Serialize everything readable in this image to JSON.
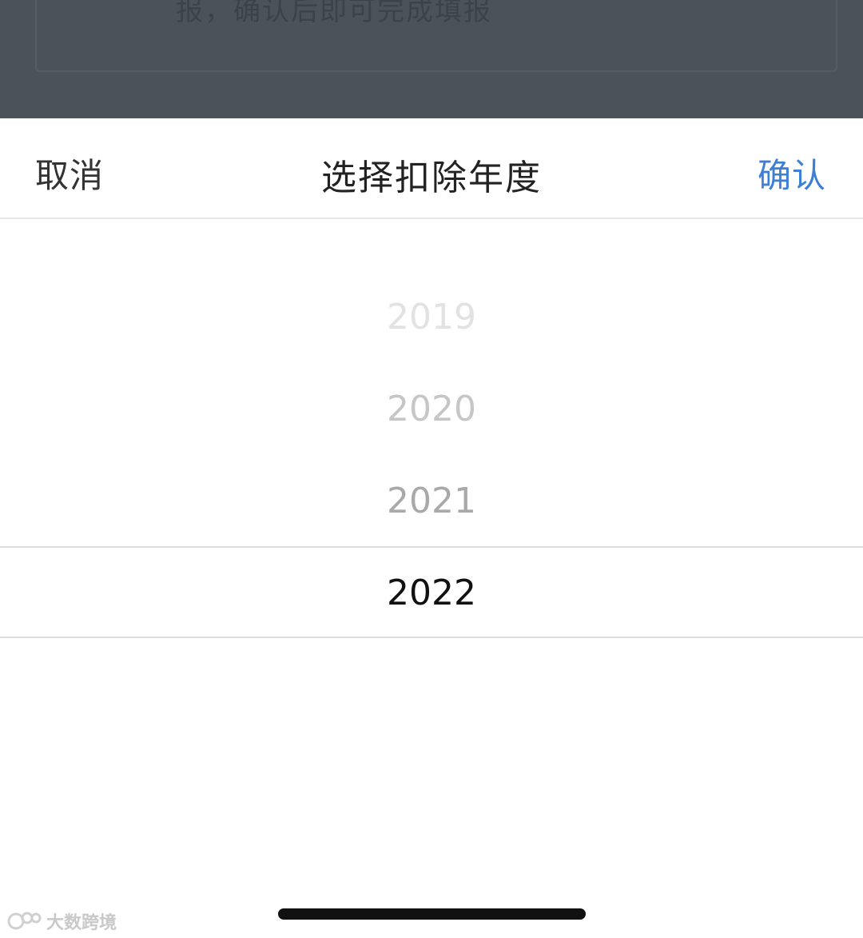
{
  "background": {
    "partial_text": "报，确认后即可完成填报"
  },
  "sheet": {
    "cancel_label": "取消",
    "title": "选择扣除年度",
    "confirm_label": "确认"
  },
  "picker": {
    "options": [
      "2019",
      "2020",
      "2021",
      "2022"
    ],
    "selected": "2022"
  },
  "watermark": {
    "text": "大数跨境"
  },
  "colors": {
    "accent": "#3d7fd6",
    "overlay": "#4b5259"
  }
}
